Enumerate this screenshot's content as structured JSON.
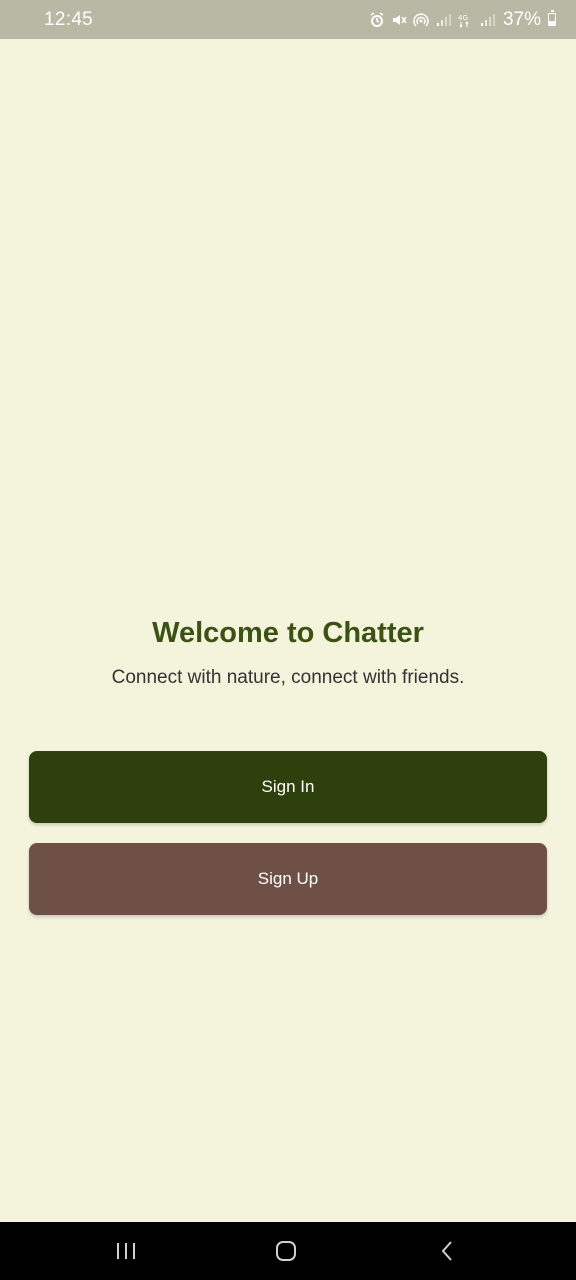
{
  "status_bar": {
    "time": "12:45",
    "battery_text": "37%",
    "battery_level_percent": 37,
    "icons": [
      "alarm-icon",
      "mute-icon",
      "hotspot-icon",
      "signal-icon",
      "4g-icon",
      "signal-icon",
      "battery-icon"
    ]
  },
  "welcome": {
    "title": "Welcome to Chatter",
    "subtitle": "Connect with nature, connect with friends."
  },
  "buttons": {
    "sign_in": "Sign In",
    "sign_up": "Sign Up"
  },
  "colors": {
    "background": "#f4f4dc",
    "title": "#3c5214",
    "sign_in_button": "#2e400b",
    "sign_up_button": "#6e5046",
    "status_bar": "#b8b8a4"
  },
  "nav_bar": {
    "icons": [
      "recent-apps-icon",
      "home-icon",
      "back-icon"
    ]
  }
}
